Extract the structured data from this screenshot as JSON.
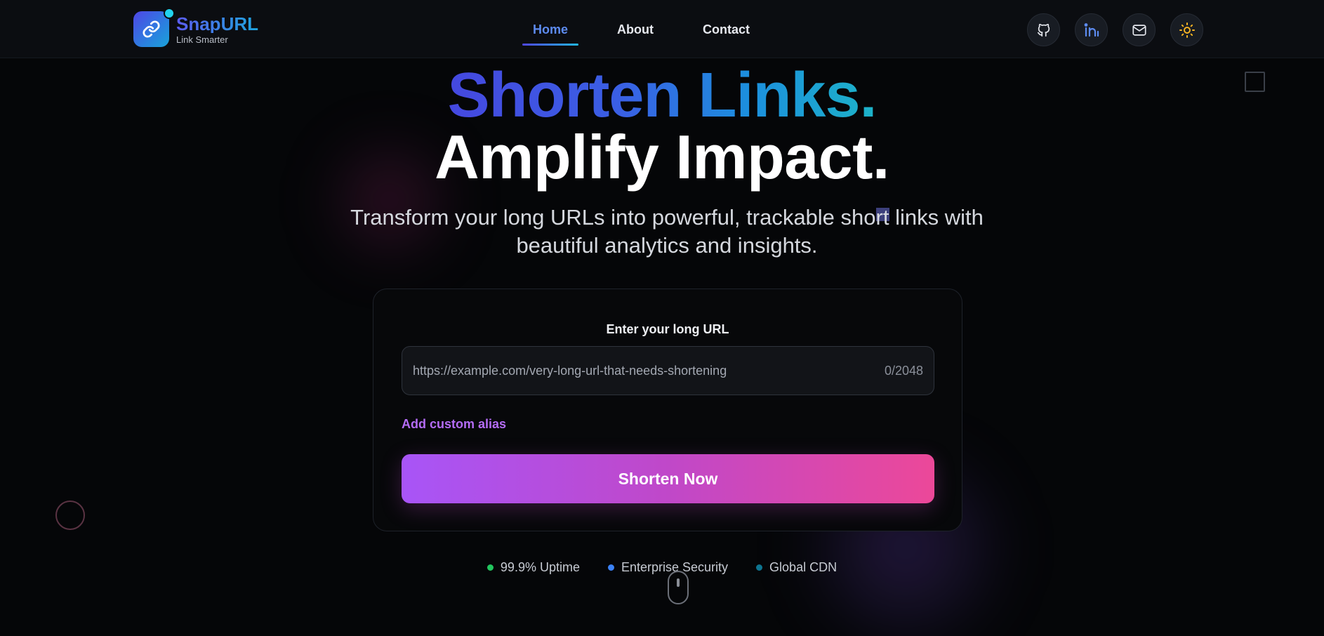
{
  "brand": {
    "name": "SnapURL",
    "tagline": "Link Smarter"
  },
  "nav": {
    "links": [
      {
        "label": "Home",
        "active": true
      },
      {
        "label": "About",
        "active": false
      },
      {
        "label": "Contact",
        "active": false
      }
    ]
  },
  "header_icons": [
    "github-icon",
    "linkedin-icon",
    "mail-icon",
    "sun-icon"
  ],
  "hero": {
    "line1": "Shorten Links.",
    "line2": "Amplify Impact.",
    "subtitle": "Transform your long URLs into powerful, trackable short links with beautiful analytics and insights."
  },
  "form": {
    "label": "Enter your long URL",
    "placeholder": "https://example.com/very-long-url-that-needs-shortening",
    "counter": "0/2048",
    "alias_link": "Add custom alias",
    "submit": "Shorten Now"
  },
  "features": [
    {
      "label": "99.9% Uptime",
      "color": "#22c55e"
    },
    {
      "label": "Enterprise Security",
      "color": "#3b82f6"
    },
    {
      "label": "Global CDN",
      "color": "#0e7490"
    }
  ],
  "colors": {
    "accent_blue": "#5d8bf0",
    "accent_purple": "#a855f7",
    "accent_pink": "#ec4899",
    "background": "#050608"
  }
}
